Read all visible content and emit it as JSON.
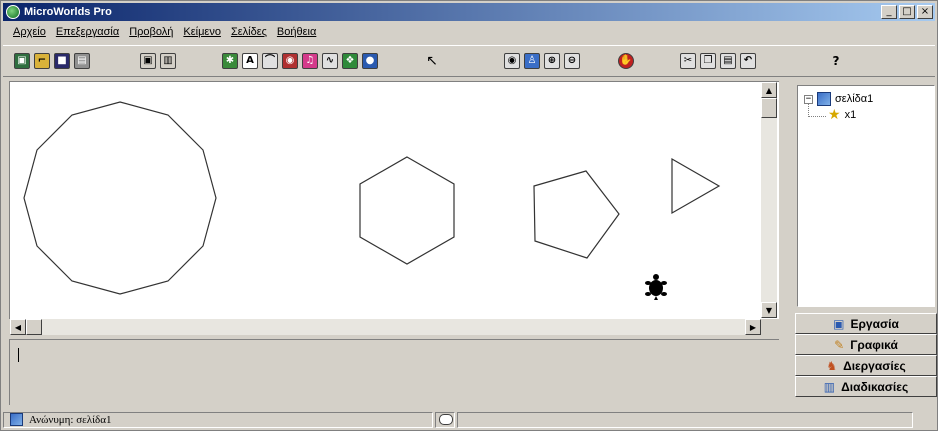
{
  "window": {
    "title": "MicroWorlds Pro",
    "buttons": {
      "minimize": "_",
      "maximize": "□",
      "close": "×"
    }
  },
  "menu": [
    "Αρχείο",
    "Επεξεργασία",
    "Προβολή",
    "Κείμενο",
    "Σελίδες",
    "Βοήθεια"
  ],
  "toolbar": {
    "icons": [
      "new-project-icon",
      "open-icon",
      "save-icon",
      "print-icon",
      "page-view-icon",
      "book-icon",
      "hatch-turtle-icon",
      "text-box-icon",
      "button-icon",
      "slider-icon",
      "music-icon",
      "sound-icon",
      "animation-icon",
      "media-icon",
      "pointer-icon",
      "eye-icon",
      "stamp-icon",
      "zoom-in-icon",
      "zoom-out-icon",
      "stop-icon",
      "scissors-icon",
      "copy-icon",
      "paste-icon",
      "undo-icon",
      "help-icon"
    ],
    "help_label": "?"
  },
  "tree": {
    "page_label": "σελίδα1",
    "turtle_label": "x1",
    "expand_symbol": "−"
  },
  "tabs": [
    {
      "label": "Εργασία",
      "icon": "project-icon"
    },
    {
      "label": "Γραφικά",
      "icon": "paint-brush-icon"
    },
    {
      "label": "Διεργασίες",
      "icon": "processes-icon"
    },
    {
      "label": "Διαδικασίες",
      "icon": "procedures-book-icon"
    }
  ],
  "status": {
    "page_text": "Ανώνυμη: σελίδα1"
  },
  "colors": {
    "window_bg": "#d4d0c8",
    "title_start": "#0a246a",
    "title_end": "#a6caf0",
    "canvas_bg": "#ffffff",
    "shape_stroke": "#333333",
    "turtle": "#000000"
  }
}
